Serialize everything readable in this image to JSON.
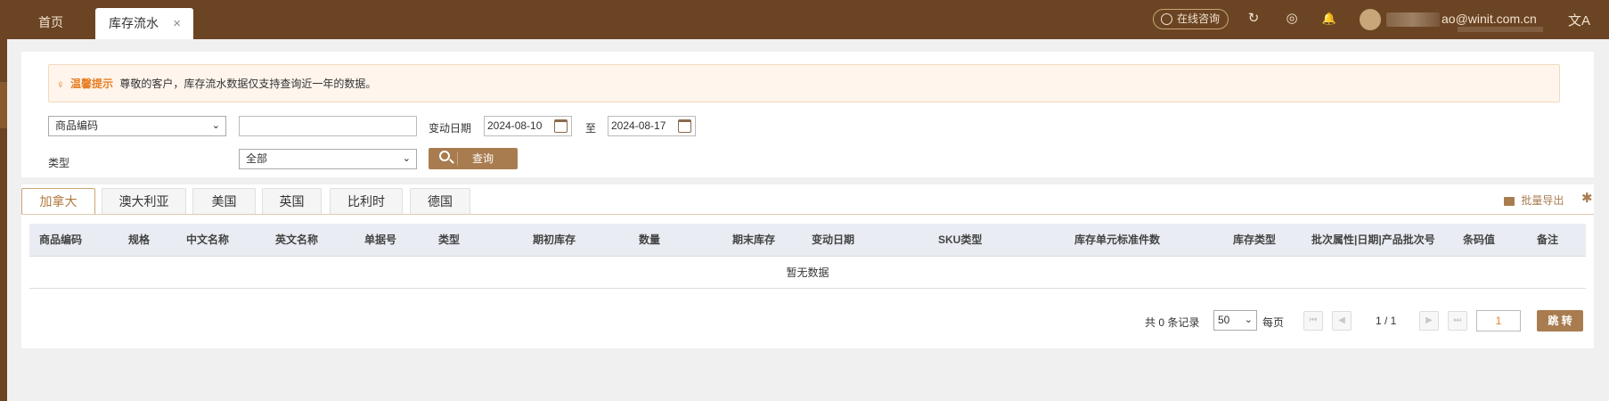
{
  "topbar": {
    "tabs": [
      {
        "label": "首页"
      },
      {
        "label": "库存流水",
        "close": "×"
      }
    ],
    "consult_label": "在线咨询",
    "icons": [
      "refresh-icon",
      "shield-check-icon",
      "bell-icon",
      "translate-icon"
    ],
    "refresh_glyph": "↻",
    "shield_glyph": "◎",
    "bell_glyph": "🔔",
    "user_email": "ao@winit.com.cn",
    "translate_glyph": "文A"
  },
  "notice": {
    "title": "温馨提示",
    "text": "尊敬的客户，库存流水数据仅支持查询近一年的数据。"
  },
  "filters": {
    "field_select": "商品编码",
    "keyword_value": "",
    "date_label": "变动日期",
    "date_from": "2024-08-10",
    "to_label": "至",
    "date_to": "2024-08-17",
    "type_label": "类型",
    "type_select": "全部",
    "query_label": "查询"
  },
  "country_tabs": [
    {
      "label": "加拿大",
      "active": true
    },
    {
      "label": "澳大利亚"
    },
    {
      "label": "美国"
    },
    {
      "label": "英国"
    },
    {
      "label": "比利时"
    },
    {
      "label": "德国"
    }
  ],
  "toolbar": {
    "export_label": "批量导出",
    "settings_glyph": "✱"
  },
  "table": {
    "columns": [
      "商品编码",
      "规格",
      "中文名称",
      "英文名称",
      "单据号",
      "类型",
      "期初库存",
      "数量",
      "期末库存",
      "变动日期",
      "SKU类型",
      "库存单元标准件数",
      "库存类型",
      "批次属性|日期|产品批次号",
      "条码值",
      "备注"
    ],
    "empty_text": "暂无数据"
  },
  "pager": {
    "total_text": "共 0 条记录",
    "page_size": "50",
    "per_page_label": "每页",
    "page_info": "1 / 1",
    "page_input": "1",
    "jump_label": "跳 转"
  },
  "colors": {
    "brand": "#6b4423",
    "accent": "#a87c4f",
    "warn": "#e67e22"
  }
}
